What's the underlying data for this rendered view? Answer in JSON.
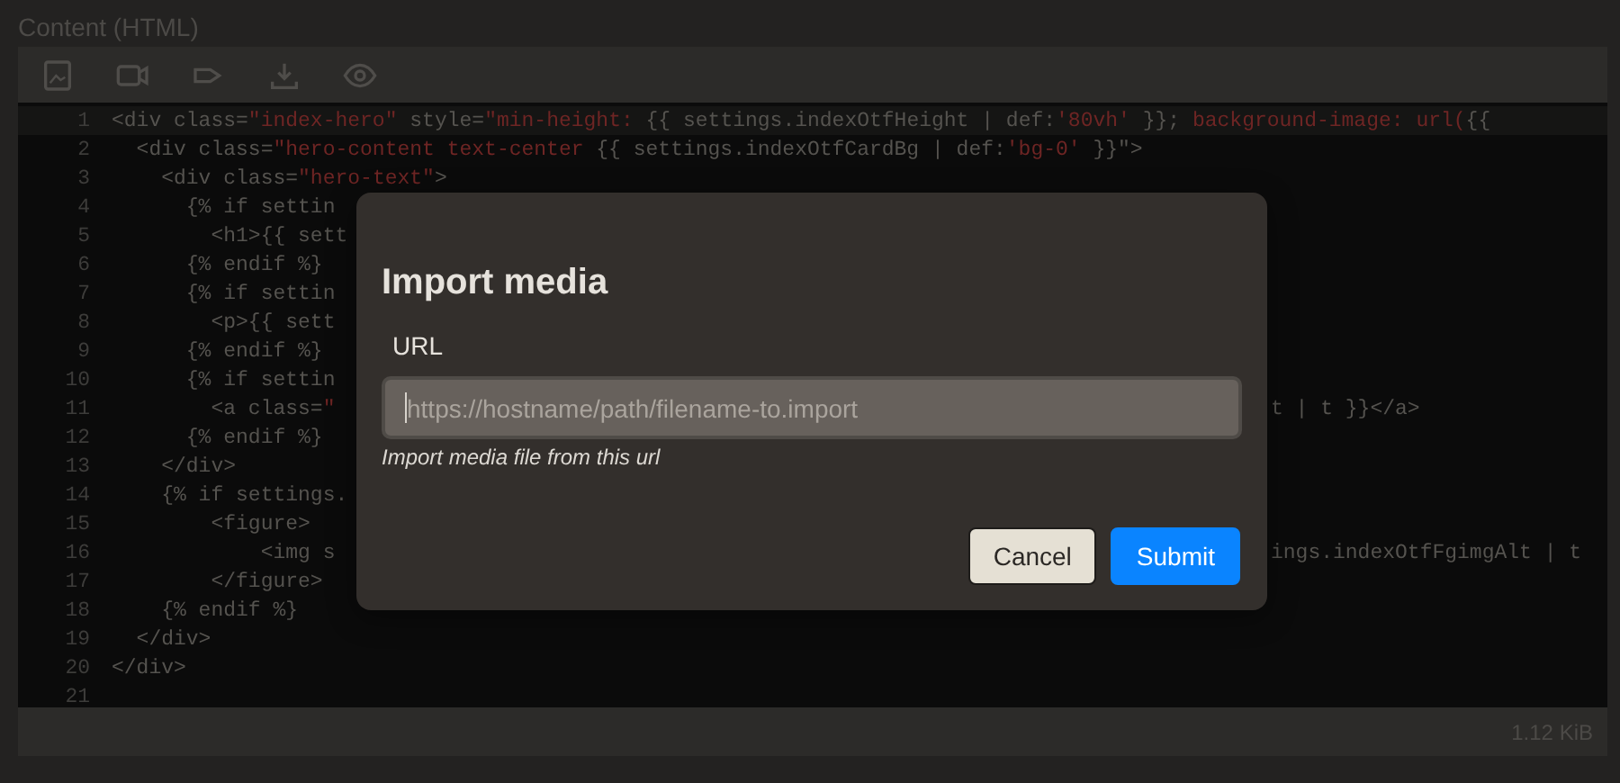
{
  "panel": {
    "title": "Content (HTML)"
  },
  "code_lines": [
    {
      "number": "1",
      "segments": [
        {
          "text": "<div class=",
          "kind": "code"
        },
        {
          "text": "\"index-hero\"",
          "kind": "string"
        },
        {
          "text": " style=",
          "kind": "code"
        },
        {
          "text": "\"min-height: ",
          "kind": "string"
        },
        {
          "text": "{{ settings.indexOtfHeight | def:",
          "kind": "code"
        },
        {
          "text": "'80vh'",
          "kind": "string"
        },
        {
          "text": " }}; ",
          "kind": "code"
        },
        {
          "text": "background-image: url(",
          "kind": "string"
        },
        {
          "text": "{{",
          "kind": "code"
        }
      ]
    },
    {
      "number": "2",
      "segments": [
        {
          "text": "  <div class=",
          "kind": "code"
        },
        {
          "text": "\"hero-content text-center ",
          "kind": "string"
        },
        {
          "text": "{{ settings.indexOtfCardBg | def:",
          "kind": "code"
        },
        {
          "text": "'bg-0'",
          "kind": "string"
        },
        {
          "text": " }}\">",
          "kind": "code"
        }
      ]
    },
    {
      "number": "3",
      "segments": [
        {
          "text": "    <div class=",
          "kind": "code"
        },
        {
          "text": "\"hero-text\"",
          "kind": "string"
        },
        {
          "text": ">",
          "kind": "code"
        }
      ]
    },
    {
      "number": "4",
      "segments": [
        {
          "text": "      {% if settin",
          "kind": "code"
        }
      ]
    },
    {
      "number": "5",
      "segments": [
        {
          "text": "        <h1>{{ sett",
          "kind": "code"
        }
      ]
    },
    {
      "number": "6",
      "segments": [
        {
          "text": "      {% endif %}",
          "kind": "code"
        }
      ]
    },
    {
      "number": "7",
      "segments": [
        {
          "text": "      {% if settin",
          "kind": "code"
        }
      ]
    },
    {
      "number": "8",
      "segments": [
        {
          "text": "        <p>{{ sett",
          "kind": "code"
        }
      ]
    },
    {
      "number": "9",
      "segments": [
        {
          "text": "      {% endif %}",
          "kind": "code"
        }
      ]
    },
    {
      "number": "10",
      "segments": [
        {
          "text": "      {% if settin",
          "kind": "code"
        }
      ]
    },
    {
      "number": "11",
      "segments": [
        {
          "text": "        <a class=",
          "kind": "code"
        },
        {
          "text": "\"",
          "kind": "string"
        }
      ],
      "tail": "t | t }}</a>"
    },
    {
      "number": "12",
      "segments": [
        {
          "text": "      {% endif %}",
          "kind": "code"
        }
      ]
    },
    {
      "number": "13",
      "segments": [
        {
          "text": "    </div>",
          "kind": "code"
        }
      ]
    },
    {
      "number": "14",
      "segments": [
        {
          "text": "    {% if settings.",
          "kind": "code"
        }
      ]
    },
    {
      "number": "15",
      "segments": [
        {
          "text": "        <figure>",
          "kind": "code"
        }
      ]
    },
    {
      "number": "16",
      "segments": [
        {
          "text": "            <img s",
          "kind": "code"
        }
      ],
      "tail": "ings.indexOtfFgimgAlt | t"
    },
    {
      "number": "17",
      "segments": [
        {
          "text": "        </figure>",
          "kind": "code"
        }
      ]
    },
    {
      "number": "18",
      "segments": [
        {
          "text": "    {% endif %}",
          "kind": "code"
        }
      ]
    },
    {
      "number": "19",
      "segments": [
        {
          "text": "  </div>",
          "kind": "code"
        }
      ]
    },
    {
      "number": "20",
      "segments": [
        {
          "text": "</div>",
          "kind": "code"
        }
      ]
    },
    {
      "number": "21"
    }
  ],
  "status_bar": {
    "size": "1.12 KiB"
  },
  "dialog": {
    "title": "Import media",
    "field": {
      "label": "URL",
      "placeholder": "https://hostname/path/filename-to.import",
      "focused": true,
      "help": "Import media file from this url"
    },
    "buttons": [
      {
        "label": "Cancel",
        "kind": "secondary"
      },
      {
        "label": "Submit",
        "kind": "primary"
      }
    ]
  }
}
